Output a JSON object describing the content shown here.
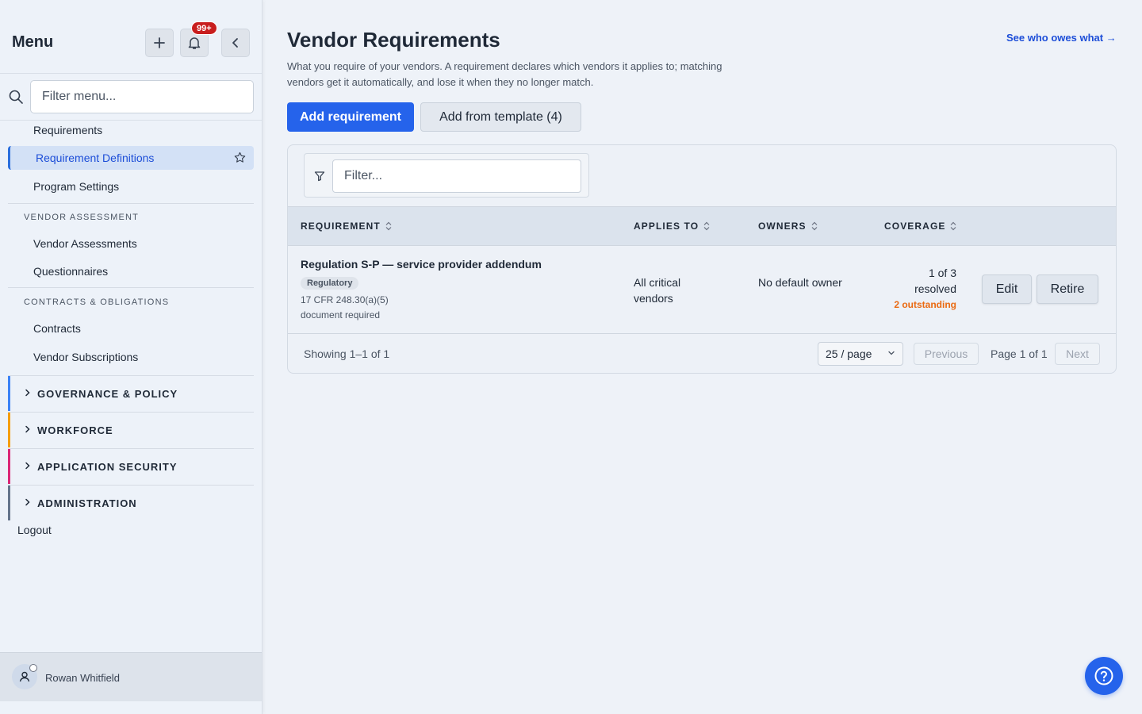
{
  "sidebar": {
    "title": "Menu",
    "notification_count": "99+",
    "filter_placeholder": "Filter menu...",
    "items_top": [
      "Requirements",
      "Requirement Definitions",
      "Program Settings"
    ],
    "sections": [
      {
        "label": "VENDOR ASSESSMENT",
        "items": [
          "Vendor Assessments",
          "Questionnaires"
        ]
      },
      {
        "label": "CONTRACTS & OBLIGATIONS",
        "items": [
          "Contracts",
          "Vendor Subscriptions"
        ]
      }
    ],
    "groups": [
      {
        "label": "GOVERNANCE & POLICY",
        "color": "#3b82f6"
      },
      {
        "label": "WORKFORCE",
        "color": "#f59e0b"
      },
      {
        "label": "APPLICATION SECURITY",
        "color": "#db2777"
      },
      {
        "label": "ADMINISTRATION",
        "color": "#64748b"
      }
    ],
    "logout": "Logout",
    "user_name": "Rowan Whitfield"
  },
  "main": {
    "title": "Vendor Requirements",
    "see_who_link": "See who owes what →",
    "description": "What you require of your vendors. A requirement declares which vendors it applies to; matching vendors get it automatically, and lose it when they no longer match.",
    "add_requirement": "Add requirement",
    "add_from_template": "Add from template (4)",
    "filter_placeholder": "Filter...",
    "columns": [
      "REQUIREMENT",
      "APPLIES TO",
      "OWNERS",
      "COVERAGE"
    ],
    "rows": [
      {
        "name": "Regulation S-P — service provider addendum",
        "tag": "Regulatory",
        "citation": "17 CFR 248.30(a)(5)",
        "citation_note": "document required",
        "applies_to": "All critical vendors",
        "owners": "No default owner",
        "coverage": "1 of 3 resolved",
        "outstanding": "2 outstanding",
        "edit": "Edit",
        "retire": "Retire"
      }
    ],
    "showing": "Showing 1–1 of 1",
    "page_size": "25 / page",
    "previous": "Previous",
    "page_info": "Page 1 of 1",
    "next": "Next"
  },
  "colors": {
    "accent": "#2563eb",
    "outstanding": "#ea6a12",
    "badge": "#c81e1e"
  }
}
